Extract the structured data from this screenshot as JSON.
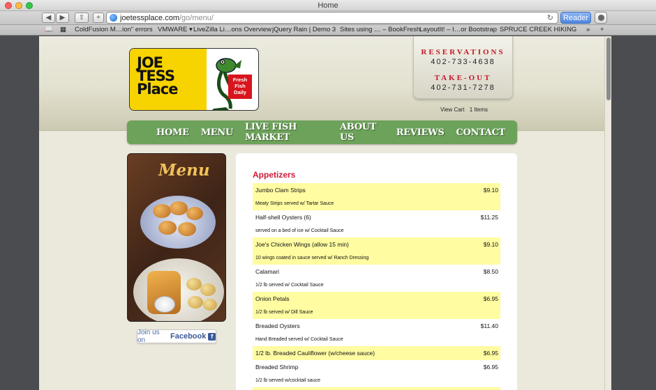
{
  "browser": {
    "window_title": "Home",
    "url_host": "joetessplace.com",
    "url_path": "/go/menu/",
    "reader_label": "Reader",
    "bookmarks": [
      "ColdFusion M…ion\" errors",
      "VMWARE ▾",
      "LiveZilla Li…ons Overview",
      "jQuery Rain | Demo 3",
      "Sites using … – BookFresh",
      "LayoutIt! – I…or Bootstrap",
      "SPRUCE CREEK HIKING"
    ]
  },
  "header": {
    "logo_line1": "JOE",
    "logo_line2": "TESS",
    "logo_line3": "Place",
    "logo_badge": "Fresh Fish Daily",
    "reservations_label": "RESERVATIONS",
    "reservations_phone": "402-733-4638",
    "takeout_label": "TAKE-OUT",
    "takeout_phone": "402-731-7278",
    "view_cart": "View Cart",
    "cart_count": "1 Items"
  },
  "nav": [
    "HOME",
    "MENU",
    "LIVE FISH MARKET",
    "ABOUT US",
    "REVIEWS",
    "CONTACT"
  ],
  "sidebar": {
    "menu_image_title": "Menu",
    "facebook_prefix": "Join us on",
    "facebook_brand": "Facebook",
    "facebook_glyph": "f"
  },
  "menu": {
    "section": "Appetizers",
    "items": [
      {
        "name": "Jumbo Clam Strips",
        "price": "$9.10",
        "desc": "Meaty Strips served w/ Tartar Sauce"
      },
      {
        "name": "Half-shell Oysters (6)",
        "price": "$11.25",
        "desc": "served on a bed of ice w/ Cocktail Sauce"
      },
      {
        "name": "Joe's Chicken Wings (allow 15 min)",
        "price": "$9.10",
        "desc": "10 wings coated in sauce served w/ Ranch Dressing"
      },
      {
        "name": "Calamari",
        "price": "$8.50",
        "desc": "1/2 lb served w/ Cocktail Sauce"
      },
      {
        "name": "Onion Petals",
        "price": "$6.95",
        "desc": "1/2 lb served w/ Dill Sauce"
      },
      {
        "name": "Breaded Oysters",
        "price": "$11.40",
        "desc": "Hand Breaded served w/ Cocktail Sauce"
      },
      {
        "name": "1/2 lb. Breaded Cauliflower (w/cheese sauce)",
        "price": "$6.95",
        "desc": ""
      },
      {
        "name": "Breaded Shrimp",
        "price": "$6.95",
        "desc": "1/2 lb served w/cocktail sauce"
      }
    ]
  },
  "colors": {
    "nav_green": "#6ca259",
    "accent_red": "#d3183a",
    "highlight_yellow": "#fffca1"
  }
}
